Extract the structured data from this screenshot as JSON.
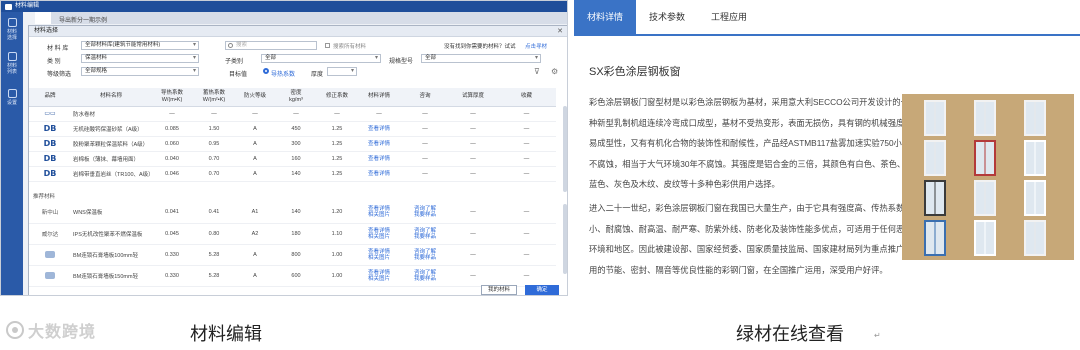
{
  "left": {
    "app_title": "材料编辑",
    "tabs": [
      "",
      "导出新分一期示例"
    ],
    "sidebar": [
      {
        "label": "材料\n选择"
      },
      {
        "label": "材料\n列表"
      },
      {
        "label": "设置"
      }
    ],
    "dialog": {
      "title": "材料选择",
      "filters": {
        "lib_label": "材 料 库",
        "lib_value": "全部材料库(建筑节能常用材料)",
        "search_placeholder": "搜索",
        "search_all": "搜索所有材料",
        "tip_text": "没有找到你需要的材料？试试",
        "tip_link": "点击寻材",
        "type_label": "类 别",
        "type_value": "保温材料",
        "subtype_label": "子类别",
        "subtype_value": "全部",
        "spec_label": "规格型号",
        "spec_value": "全部",
        "grade_label": "等级筛选",
        "grade_value": "全部规格",
        "target_label": "目标值",
        "target_option": "导热系数",
        "target_value2": "厚度"
      },
      "columns": [
        "品牌",
        "材料名称",
        "导热系数\nW/(m•K)",
        "蓄热系数\nW/(m²•K)",
        "防火等级",
        "密度\nkg/m³",
        "修正系数",
        "材料详情",
        "咨询",
        "试算厚度",
        "收藏"
      ],
      "rows": [
        {
          "brand": "ding",
          "name": "防水卷材",
          "k": "—",
          "s": "—",
          "fire": "—",
          "density": "—",
          "factor": "—",
          "detail": "—",
          "ask": "—",
          "calc": "—",
          "fav": "—"
        },
        {
          "brand": "DB",
          "name": "无机硅酸钙保温砂浆（A级）",
          "k": "0.085",
          "s": "1.50",
          "fire": "A",
          "density": "450",
          "factor": "1.25",
          "detail": "查看详情",
          "ask": "—",
          "calc": "—",
          "fav": "—"
        },
        {
          "brand": "DB",
          "name": "胶粉聚苯颗粒保温浆料（A级）",
          "k": "0.060",
          "s": "0.95",
          "fire": "A",
          "density": "300",
          "factor": "1.25",
          "detail": "查看详情",
          "ask": "—",
          "calc": "—",
          "fav": "—"
        },
        {
          "brand": "DB",
          "name": "岩棉板（薄抹、幕墙用面）",
          "k": "0.040",
          "s": "0.70",
          "fire": "A",
          "density": "160",
          "factor": "1.25",
          "detail": "查看详情",
          "ask": "—",
          "calc": "—",
          "fav": "—"
        },
        {
          "brand": "DB",
          "name": "岩棉带垂直岩丝（TR100、A级）",
          "k": "0.046",
          "s": "0.70",
          "fire": "A",
          "density": "140",
          "factor": "1.25",
          "detail": "查看详情",
          "ask": "—",
          "calc": "—",
          "fav": "—"
        }
      ],
      "section2_label": "推荐材料",
      "rows2": [
        {
          "brand": "新中山",
          "name": "WNS保温板",
          "k": "0.041",
          "s": "0.41",
          "fire": "A1",
          "density": "140",
          "factor": "1.20",
          "detail": "查看详情\n相关图片",
          "ask": "咨询了解\n我要样品",
          "calc": "—",
          "fav": "—"
        },
        {
          "brand": "威尔达",
          "name": "IPS无机改性聚苯不燃保温板",
          "k": "0.045",
          "s": "0.80",
          "fire": "A2",
          "density": "180",
          "factor": "1.10",
          "detail": "查看详情\n相关图片",
          "ask": "咨询了解\n我要样品",
          "calc": "—",
          "fav": "—"
        },
        {
          "brand": "",
          "name": "BM连锁石膏墙板100mm轻",
          "k": "0.330",
          "s": "5.28",
          "fire": "A",
          "density": "800",
          "factor": "1.00",
          "detail": "查看详情\n相关图片",
          "ask": "咨询了解\n我要样品",
          "calc": "—",
          "fav": "—"
        },
        {
          "brand": "",
          "name": "BM连锁石膏墙板150mm轻",
          "k": "0.330",
          "s": "5.28",
          "fire": "A",
          "density": "600",
          "factor": "1.00",
          "detail": "查看详情\n相关图片",
          "ask": "咨询了解\n我要样品",
          "calc": "—",
          "fav": "—"
        }
      ],
      "btn_my": "我的材料",
      "btn_ok": "确定"
    }
  },
  "right": {
    "tabs": [
      "材料详情",
      "技术参数",
      "工程应用"
    ],
    "active_tab": 0,
    "product_title": "SX彩色涂层钢板窗",
    "para1_lines": [
      "彩色涂层钢板门窗型材是以彩色涂层钢板为基材，采用意大利SECCO公司开发设计的一",
      "种新型乳制机组连续冷弯成口成型，基材不受热变形，表面无损伤，具有钢的机械强度和",
      "易成型性，又有有机化合物的装饰性和耐候性，产品经ASTMB117盐雾加速实验750小时",
      "不腐蚀，相当于大气环境30年不腐蚀。其强度是铝合金的三倍，其颜色有白色、茶色、",
      "蓝色、灰色及木纹、皮纹等十多种色彩供用户选择。"
    ],
    "para2_lines": [
      "进入二十一世纪，彩色涂层钢板门窗在我国已大量生产，由于它具有强度高、传热系数",
      "小、耐腐蚀、耐高温、耐严寒、防紫外线、防老化及装饰性能多优点，可适用于任何恶劣的",
      "环境和地区。因此被建设部、国家经贸委、国家质量技监局、国家建材局列为重点推广运",
      "用的节能、密封、隔音等优良性能的彩钢门窗，在全国推广运用，深受用户好评。"
    ]
  },
  "captions": {
    "left": "材料编辑",
    "right": "绿材在线查看",
    "logo": "大数跨境"
  },
  "colors": {
    "app_blue": "#1f4e9a",
    "link_blue": "#2f6bd8",
    "tab_blue": "#3a73c6",
    "panel_tan": "#c7a878"
  }
}
